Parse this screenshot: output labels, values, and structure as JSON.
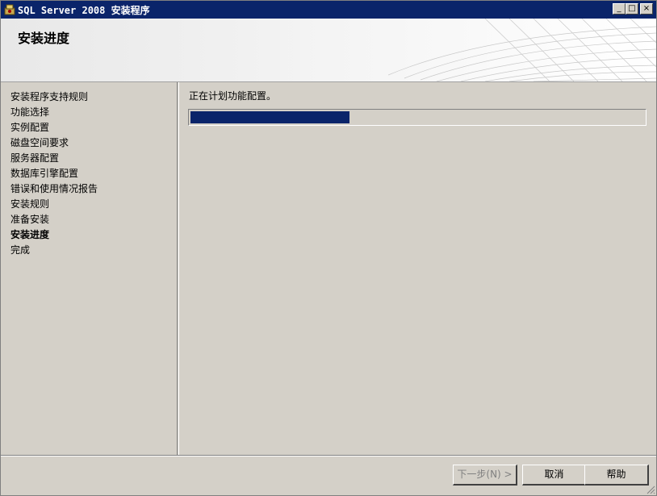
{
  "window": {
    "title": "SQL Server 2008 安装程序",
    "minimize": "_",
    "maximize": "□",
    "close": "×"
  },
  "header": {
    "title": "安装进度"
  },
  "sidebar": {
    "steps": [
      "安装程序支持规则",
      "功能选择",
      "实例配置",
      "磁盘空间要求",
      "服务器配置",
      "数据库引擎配置",
      "错误和使用情况报告",
      "安装规则",
      "准备安装",
      "安装进度",
      "完成"
    ],
    "current_index": 9
  },
  "main": {
    "status": "正在计划功能配置。",
    "progress_percent": 35
  },
  "buttons": {
    "next": "下一步(N) >",
    "cancel": "取消",
    "help": "帮助"
  },
  "colors": {
    "accent": "#0a246a",
    "face": "#d4d0c8"
  }
}
